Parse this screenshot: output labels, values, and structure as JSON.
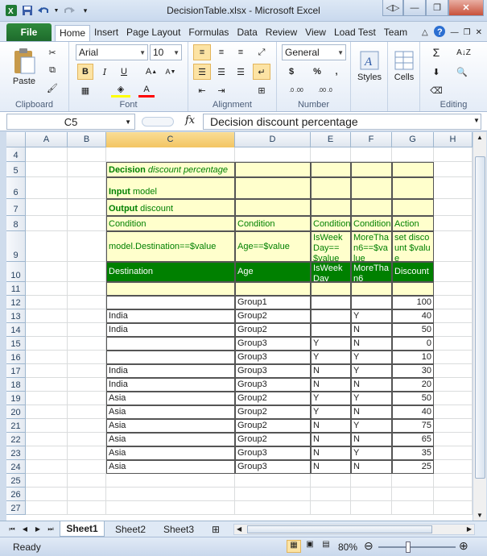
{
  "window": {
    "title": "DecisionTable.xlsx  -  Microsoft Excel"
  },
  "qat": {
    "icons": [
      "excel-logo-icon",
      "save-icon",
      "undo-icon",
      "redo-icon",
      "customize-icon"
    ]
  },
  "tabs": {
    "file": "File",
    "items": [
      "Home",
      "Insert",
      "Page Layout",
      "Formulas",
      "Data",
      "Review",
      "View",
      "Load Test",
      "Team"
    ]
  },
  "ribbon": {
    "clipboard": {
      "label": "Clipboard",
      "paste": "Paste"
    },
    "font": {
      "label": "Font",
      "name": "Arial",
      "size": "10",
      "bold": "B",
      "italic": "I",
      "underline": "U",
      "font_color": "A"
    },
    "alignment": {
      "label": "Alignment"
    },
    "number": {
      "label": "Number",
      "format": "General",
      "currency": "$",
      "percent": "%",
      "comma": ",",
      "inc": ".0 .00",
      "dec": ".00 .0"
    },
    "styles": {
      "label": "Styles"
    },
    "cells": {
      "label": "Cells"
    },
    "editing": {
      "label": "Editing"
    }
  },
  "formula_bar": {
    "name_box": "C5",
    "fx": "fx",
    "value": "Decision discount percentage"
  },
  "columns": [
    "A",
    "B",
    "C",
    "D",
    "E",
    "F",
    "G",
    "H"
  ],
  "rows": [
    "4",
    "5",
    "6",
    "7",
    "8",
    "9",
    "10",
    "11",
    "12",
    "13",
    "14",
    "15",
    "16",
    "17",
    "18",
    "19",
    "20",
    "21",
    "22",
    "23",
    "24",
    "25",
    "26",
    "27"
  ],
  "table": {
    "r5": {
      "bold": "Decision",
      "rest": " discount percentage"
    },
    "r6": {
      "bold": "Input",
      "rest": " model"
    },
    "r7": {
      "bold": "Output",
      "rest": " discount"
    },
    "r8": [
      "Condition",
      "Condition",
      "Condition",
      "Condition",
      "Action"
    ],
    "r9": [
      "model.Destination==$value",
      "Age==$value",
      "IsWeekDay==$value",
      "MoreThan6==$value",
      "set discount $value"
    ],
    "r10": [
      "Destination",
      "Age",
      "IsWeekDay",
      "MoreThan6",
      "Discount"
    ],
    "data": [
      [
        "",
        "Group1",
        "",
        "",
        "100"
      ],
      [
        "India",
        "Group2",
        "",
        "Y",
        "40"
      ],
      [
        "India",
        "Group2",
        "",
        "N",
        "50"
      ],
      [
        "",
        "Group3",
        "Y",
        "N",
        "0"
      ],
      [
        "",
        "Group3",
        "Y",
        "Y",
        "10"
      ],
      [
        "India",
        "Group3",
        "N",
        "Y",
        "30"
      ],
      [
        "India",
        "Group3",
        "N",
        "N",
        "20"
      ],
      [
        "Asia",
        "Group2",
        "Y",
        "Y",
        "50"
      ],
      [
        "Asia",
        "Group2",
        "Y",
        "N",
        "40"
      ],
      [
        "Asia",
        "Group2",
        "N",
        "Y",
        "75"
      ],
      [
        "Asia",
        "Group2",
        "N",
        "N",
        "65"
      ],
      [
        "Asia",
        "Group3",
        "N",
        "Y",
        "35"
      ],
      [
        "Asia",
        "Group3",
        "N",
        "N",
        "25"
      ]
    ]
  },
  "sheets": [
    "Sheet1",
    "Sheet2",
    "Sheet3"
  ],
  "status": {
    "ready": "Ready",
    "zoom": "80%"
  },
  "colors": {
    "header_green": "#008000",
    "yellow": "#ffffcc",
    "file_tab": "#1e6b2c"
  }
}
